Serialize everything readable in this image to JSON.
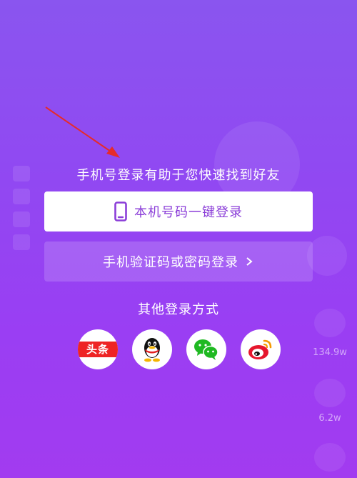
{
  "login": {
    "hint": "手机号登录有助于您快速找到好友",
    "one_tap_button": "本机号码一键登录",
    "sms_button": "手机验证码或密码登录",
    "other_title": "其他登录方式",
    "socials": [
      {
        "label": "头条",
        "icon": "toutiao-icon"
      },
      {
        "label": "",
        "icon": "qq-icon"
      },
      {
        "label": "",
        "icon": "wechat-icon"
      },
      {
        "label": "",
        "icon": "weibo-icon"
      }
    ]
  },
  "background": {
    "like_count": "134.9w",
    "comment_count": "6.2w"
  },
  "colors": {
    "accent": "#8b3ed8",
    "toutiao_red": "#ee2424",
    "annotation_arrow": "#e52b2b"
  }
}
